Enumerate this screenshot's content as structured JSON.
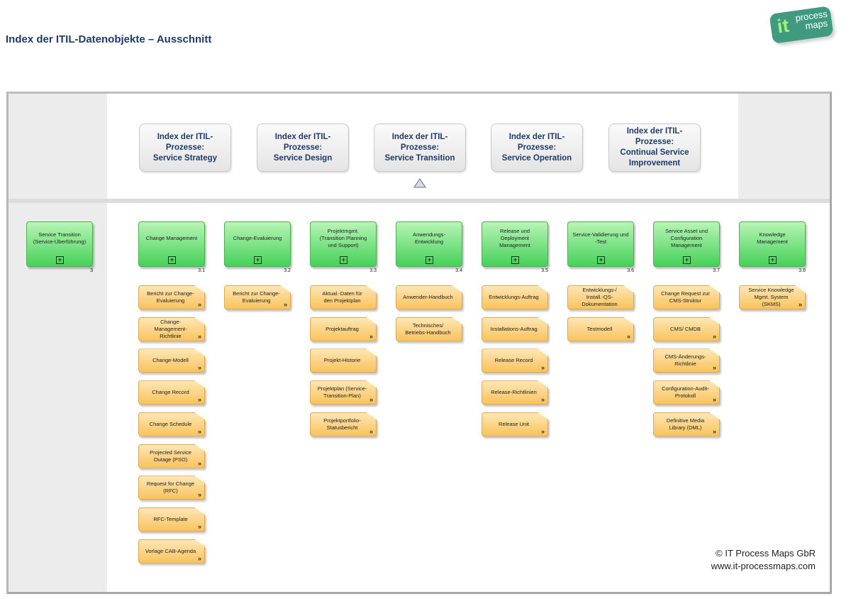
{
  "header": {
    "title": "Index der ITIL-Datenobjekte – Ausschnitt",
    "logo": {
      "it": "it",
      "process": "process",
      "maps": "maps"
    }
  },
  "index_boxes": [
    {
      "label": "Index der ITIL-\nProzesse:\nService Strategy"
    },
    {
      "label": "Index der ITIL-\nProzesse:\nService Design"
    },
    {
      "label": "Index der ITIL-\nProzesse:\nService Transition"
    },
    {
      "label": "Index der ITIL-\nProzesse:\nService Operation"
    },
    {
      "label": "Index der ITIL-\nProzesse:\nContinual Service\nImprovement"
    }
  ],
  "active_marker": "triangle-up-icon",
  "root_process": {
    "label": "Service Transition\n(Service-Überführung)",
    "number": "3"
  },
  "processes": [
    {
      "label": "Change Management",
      "number": "3.1",
      "documents": [
        {
          "label": "Bericht zur Change-\nEvaluierung",
          "more": true
        },
        {
          "label": "Change-\nManagement-\nRichtlinie",
          "more": true
        },
        {
          "label": "Change-Modell",
          "more": true
        },
        {
          "label": "Change Record",
          "more": true
        },
        {
          "label": "Change Schedule",
          "more": true
        },
        {
          "label": "Projected Service\nOutage (PSO)",
          "more": true
        },
        {
          "label": "Request for Change\n(RFC)",
          "more": true
        },
        {
          "label": "RFC-Template",
          "more": true
        },
        {
          "label": "Vorlage CAB-Agenda",
          "more": true
        }
      ]
    },
    {
      "label": "Change-Evaluierung",
      "number": "3.2",
      "documents": [
        {
          "label": "Bericht zur Change-\nEvaluierung",
          "more": true
        }
      ]
    },
    {
      "label": "Projektmgmt.\n(Transition Planning\nund Support)",
      "number": "3.3",
      "documents": [
        {
          "label": "Aktual.-Daten für\nden Projektplan",
          "more": false
        },
        {
          "label": "Projektauftrag",
          "more": true
        },
        {
          "label": "Projekt-Historie",
          "more": false
        },
        {
          "label": "Projektplan (Service-\nTransition-Plan)",
          "more": true
        },
        {
          "label": "Projektportfolio-\nStatusbericht",
          "more": true
        }
      ]
    },
    {
      "label": "Anwendungs-\nEntwicklung",
      "number": "3.4",
      "documents": [
        {
          "label": "Anwender-Handbuch",
          "more": false
        },
        {
          "label": "Technisches/\nBetriebs-Handbuch",
          "more": false
        }
      ]
    },
    {
      "label": "Release und\nDeployment\nManagement",
      "number": "3.5",
      "documents": [
        {
          "label": "Entwicklungs-Auftrag",
          "more": false
        },
        {
          "label": "Installations-Auftrag",
          "more": false
        },
        {
          "label": "Release Record",
          "more": true
        },
        {
          "label": "Release-Richtlinien",
          "more": true
        },
        {
          "label": "Release Unit",
          "more": true
        }
      ]
    },
    {
      "label": "Service-Validierung und\n-Test",
      "number": "3.6",
      "documents": [
        {
          "label": "Entwicklungs-/\nInstall.-QS-\nDokumentation",
          "more": false
        },
        {
          "label": "Testmodell",
          "more": true
        }
      ]
    },
    {
      "label": "Service Asset und\nConfiguration\nManagement",
      "number": "3.7",
      "documents": [
        {
          "label": "Change Request zur\nCMS-Struktur",
          "more": false
        },
        {
          "label": "CMS/ CMDB",
          "more": true
        },
        {
          "label": "CMS-Änderungs-\nRichtlinie",
          "more": true
        },
        {
          "label": "Configuration-Audit-\nProtokoll",
          "more": true
        },
        {
          "label": "Definitive Media\nLibrary (DML)",
          "more": true
        }
      ]
    },
    {
      "label": "Knowledge\nManagement",
      "number": "3.8",
      "documents": [
        {
          "label": "Service Knowledge\nMgmt. System\n(SKMS)",
          "more": true
        }
      ]
    }
  ],
  "symbols": {
    "expand": "+",
    "more": "»"
  },
  "footer": {
    "copyright": "© IT Process Maps GbR",
    "url": "www.it-processmaps.com"
  },
  "colors": {
    "title": "#1f3b66",
    "process_green": "#46d15a",
    "document_orange": "#f9c35c",
    "logo_green": "#3f9a80"
  }
}
